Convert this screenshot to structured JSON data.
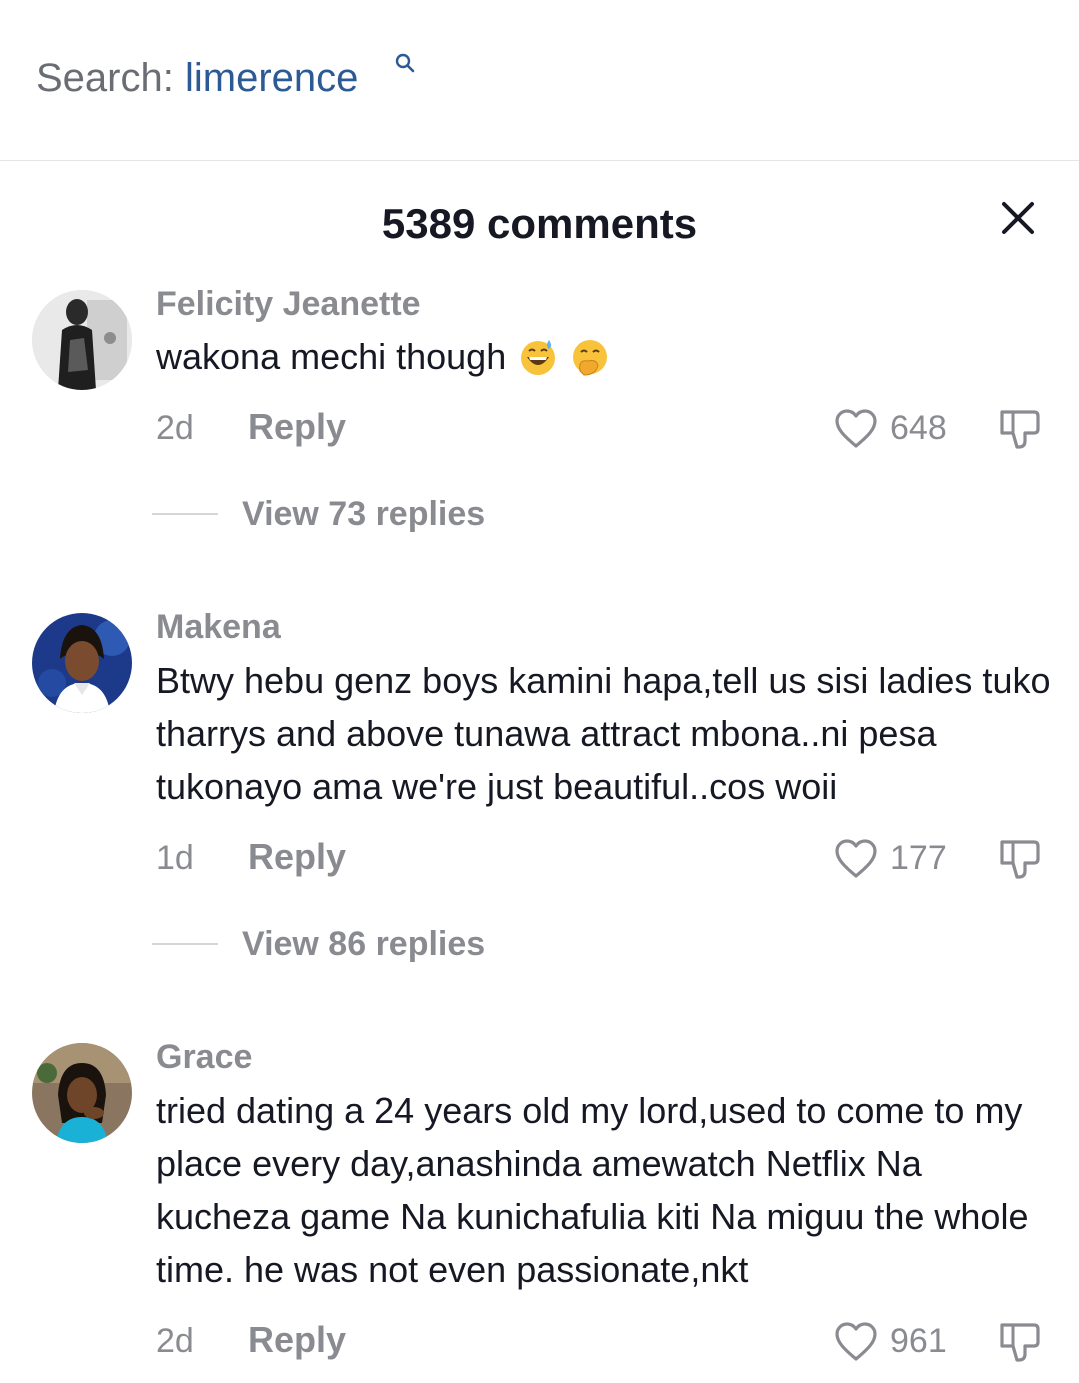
{
  "search": {
    "prefix": "Search:",
    "term": "limerence",
    "icon": "search-icon"
  },
  "header": {
    "title": "5389 comments",
    "close_icon": "close-icon"
  },
  "comments": [
    {
      "username": "Felicity Jeanette",
      "text": "wakona mechi though",
      "emojis": [
        "grinning-sweat-emoji",
        "hand-over-mouth-emoji"
      ],
      "time": "2d",
      "reply_label": "Reply",
      "likes": "648",
      "view_replies": "View 73 replies"
    },
    {
      "username": "Makena",
      "text": "Btwy hebu genz boys kamini hapa,tell us sisi ladies tuko tharrys and above tunawa attract mbona..ni pesa tukonayo ama we're just beautiful..cos woii",
      "time": "1d",
      "reply_label": "Reply",
      "likes": "177",
      "view_replies": "View 86 replies"
    },
    {
      "username": "Grace",
      "text": "tried dating a 24 years old my lord,used to come to my place every day,anashinda amewatch Netflix Na kucheza game Na kunichafulia kiti Na miguu the whole time. he was not even passionate,nkt",
      "time": "2d",
      "reply_label": "Reply",
      "likes": "961"
    }
  ],
  "colors": {
    "accent_link": "#2c5a95",
    "muted_text": "#8a8b91",
    "primary_text": "#161823"
  }
}
